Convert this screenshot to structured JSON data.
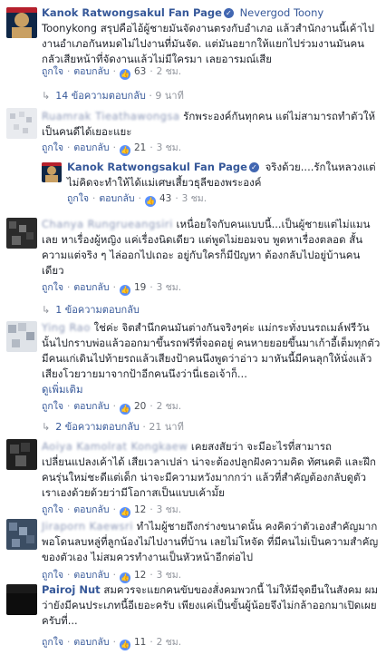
{
  "comments": [
    {
      "name": "Kanok Ratwongsakul Fan Page",
      "tag": "Nevergod Toony",
      "text": "Toonykong สรุปคือไอ้ผู้ชายมันจัดงานตรงกับอำเภอ แล้วสำนักงานนี้เค้าไปงานอำเภอกันหมดไม่ไปงานที่มันจัด. แต่มันอยากให้แยกไปร่วมงานมันคนกลัวเสียหน้าที่จัดงานแล้วไม่มีใครมา เลยอารมณ์เสีย",
      "like": "ถูกใจ",
      "reply": "ตอบกลับ",
      "likes": "63",
      "time": "2 ชม.",
      "replies_text": "14 ข้อความตอบกลับ",
      "replies_time": "9 นาที"
    },
    {
      "name": "Ruamrak Tieathawongsa",
      "text": "รักพระองค์กันทุกคน แต่ไม่สามารถทำตัวให้เป็นคนดีได้เยอะแยะ",
      "like": "ถูกใจ",
      "reply": "ตอบกลับ",
      "likes": "21",
      "time": "3 ชม."
    },
    {
      "name": "Kanok Ratwongsakul Fan Page",
      "text": "จริงด้วย....รักในหลวงแต่ไม่คิดจะทำให้ได้แม่เศษเสี้ยวธุลีของพระองค์",
      "like": "ถูกใจ",
      "reply": "ตอบกลับ",
      "likes": "43",
      "time": "3 ชม."
    },
    {
      "name": "Chanya Rungrueangsiri",
      "text": "เหนื่อยใจกับคนแบบนี้...เป็นผู้ชายแต่ไม่แมนเลย หาเรื่องผู้หญิง แค่เรื่องนิดเดียว แต่พูดไม่ยอมจบ พูดหาเรื่องตลอด สั้นความแต่จริง ๆ ไล่ออกไปเถอะ อยู่กับใครก็มีปัญหา ต้องกลับไปอยู่บ้านคนเดียว",
      "like": "ถูกใจ",
      "reply": "ตอบกลับ",
      "likes": "19",
      "time": "3 ชม.",
      "replies_text": "1 ข้อความตอบกลับ"
    },
    {
      "name": "Ying Rao",
      "text": "ใช่ค่ะ จิตสำนึกคนมันต่างกันจริงๆค่ะ แม่กระทั่งบนรถเมล์ฟรีวันนั้นไปกราบพ่อแล้วออกมาขึ้นรถฟรีที่จอดอยู่ คนหายยอยขึ้นมาเก้าอี้เต็มทุกตัว มีคนแก่เดินไปท้ายรถแล้วเสียงป้าคนนึงพูดว่าอ่าว มาหันนี้มีคนลุกให้นั่งแล้ว เสียงโวยวายมาจากป้าอีกคนนึงว่านี่เธอเจ้าก็...",
      "see_more": "ดูเพิ่มเติม",
      "like": "ถูกใจ",
      "reply": "ตอบกลับ",
      "likes": "20",
      "time": "2 ชม.",
      "replies_text": "2 ข้อความตอบกลับ",
      "replies_time": "21 นาที"
    },
    {
      "name": "Aoiya Kamolrat Kongkaew",
      "text": "เคยสงสัยว่า จะมีอะไรที่สามารถเปลี่ยนแปลงเค้าได้ เสียเวลาเปล่า น่าจะต้องปลูกฝังความคิด ทัศนคติ และฝึกคนรุ่นใหม่ชะดีแต่เด็ก น่าจะมีความหวังมากกว่า แล้วที่สำคัญต้องกลับดูตัวเราเองด้วยด้วยว่ามีโอกาสเป็นแบบเค้ามั้ย",
      "like": "ถูกใจ",
      "reply": "ตอบกลับ",
      "likes": "12",
      "time": "3 ชม."
    },
    {
      "name": "Jiraporn Kaewsri",
      "text": "ทำไมผู้ชายถึงกร่างขนาดนั้น คงคิดว่าตัวเองสำคัญมาก พอโดนลบหลู่ที่ลูกน้องไม่ไปงานที่บ้าน เลยไม่โหจัด ที่มีคนไม่เป็นความสำคัญของตัวเอง ไม่สมควรทำงานเป็นหัวหน้าอีกต่อไป",
      "like": "ถูกใจ",
      "reply": "ตอบกลับ",
      "likes": "12",
      "time": "3 ชม."
    },
    {
      "name": "Pairoj Nut",
      "text": "สมควรจะแยกคนขับของสั่งคมพวกนี้ ไม่ให้มีจุดยืนในสังคม ผมว่ายังมีคนประเภทนี้อีเยอะครับ เพียงแค่เป็นขั้นผู้น้อยจึงไม่กล้าออกมาเปิดเผยครับที่...",
      "like": "ถูกใจ",
      "reply": "ตอบกลับ",
      "likes": "11",
      "time": "2 ชม."
    }
  ],
  "colors": {
    "link": "#365899",
    "meta": "#90949c",
    "like_badge": "#5890ff",
    "verified": "#4267b2"
  }
}
